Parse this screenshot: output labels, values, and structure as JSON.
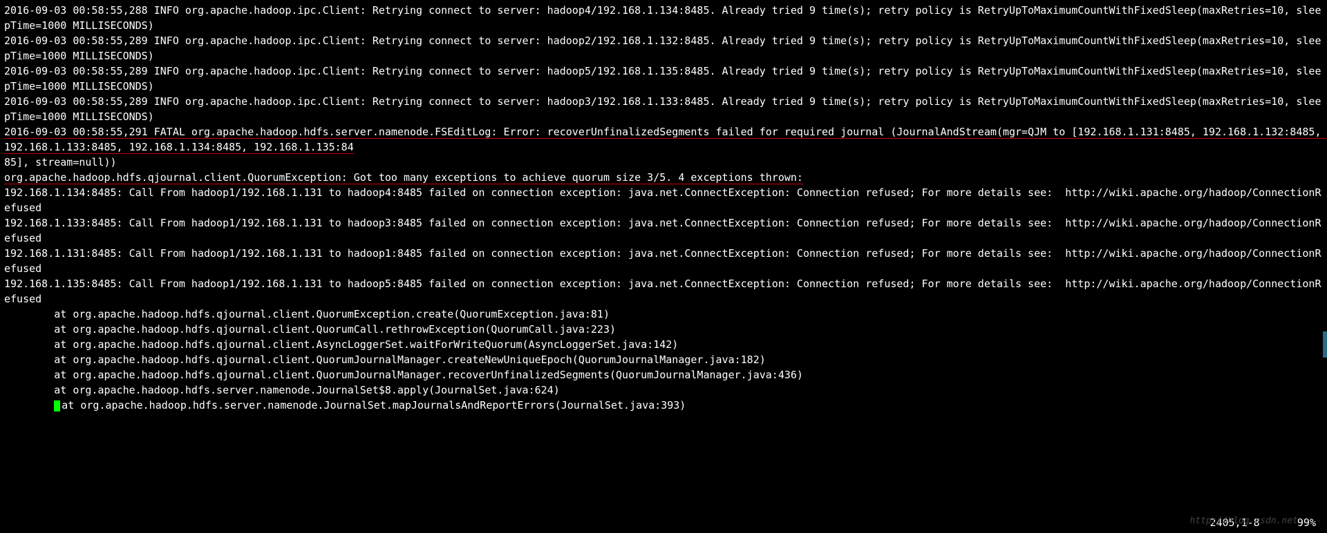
{
  "log": {
    "info1_a": "2016-09-03 00:58:55,288 INFO org.apache.hadoop.ipc.Client: Retrying connect to server: hadoop4/192.168.1.134:8485. Already tried 9 time(s); retry policy is RetryUpToMaximumCountWithFixedSleep(maxRetries=10, sleepTime=1000 MILLISECONDS)",
    "info2_a": "2016-09-03 00:58:55,289 INFO org.apache.hadoop.ipc.Client: Retrying connect to server: hadoop2/192.168.1.132:8485. Already tried 9 time(s); retry policy is RetryUpToMaximumCountWithFixedSleep(maxRetries=10, sleepTime=1000 MILLISECONDS)",
    "info3_a": "2016-09-03 00:58:55,289 INFO org.apache.hadoop.ipc.Client: Retrying connect to server: hadoop5/192.168.1.135:8485. Already tried 9 time(s); retry policy is RetryUpToMaximumCountWithFixedSleep(maxRetries=10, sleepTime=1000 MILLISECONDS)",
    "info4_a": "2016-09-03 00:58:55,289 INFO org.apache.hadoop.ipc.Client: Retrying connect to server: hadoop3/192.168.1.133:8485. Already tried 9 time(s); retry policy is RetryUpToMaximumCountWithFixedSleep(maxRetries=10, sleepTime=1000 MILLISECONDS)",
    "fatal_a": "2016-09-03 00:58:55,291 FATAL org.apache.hadoop.hdfs.server.namenode.FSEditLog: Error: recoverUnfinalizedSegments failed for required journal (JournalAndStream(mgr=QJM to [192.168.1.131:8485, 192.168.1.132:8485, 192.168.1.133:8485, 192.168.1.134:8485, 192.168.1.135:84",
    "fatal_b": "85], stream=null))",
    "quorum": "org.apache.hadoop.hdfs.qjournal.client.QuorumException: Got too many exceptions to achieve quorum size 3/5. 4 exceptions thrown:",
    "ex1": "192.168.1.134:8485: Call From hadoop1/192.168.1.131 to hadoop4:8485 failed on connection exception: java.net.ConnectException: Connection refused; For more details see:  http://wiki.apache.org/hadoop/ConnectionRefused",
    "ex2": "192.168.1.133:8485: Call From hadoop1/192.168.1.131 to hadoop3:8485 failed on connection exception: java.net.ConnectException: Connection refused; For more details see:  http://wiki.apache.org/hadoop/ConnectionRefused",
    "ex3": "192.168.1.131:8485: Call From hadoop1/192.168.1.131 to hadoop1:8485 failed on connection exception: java.net.ConnectException: Connection refused; For more details see:  http://wiki.apache.org/hadoop/ConnectionRefused",
    "ex4": "192.168.1.135:8485: Call From hadoop1/192.168.1.131 to hadoop5:8485 failed on connection exception: java.net.ConnectException: Connection refused; For more details see:  http://wiki.apache.org/hadoop/ConnectionRefused",
    "st1": "        at org.apache.hadoop.hdfs.qjournal.client.QuorumException.create(QuorumException.java:81)",
    "st2": "        at org.apache.hadoop.hdfs.qjournal.client.QuorumCall.rethrowException(QuorumCall.java:223)",
    "st3": "        at org.apache.hadoop.hdfs.qjournal.client.AsyncLoggerSet.waitForWriteQuorum(AsyncLoggerSet.java:142)",
    "st4": "        at org.apache.hadoop.hdfs.qjournal.client.QuorumJournalManager.createNewUniqueEpoch(QuorumJournalManager.java:182)",
    "st5": "        at org.apache.hadoop.hdfs.qjournal.client.QuorumJournalManager.recoverUnfinalizedSegments(QuorumJournalManager.java:436)",
    "st6": "        at org.apache.hadoop.hdfs.server.namenode.JournalSet$8.apply(JournalSet.java:624)",
    "st7_pad": "        ",
    "st7": "at org.apache.hadoop.hdfs.server.namenode.JournalSet.mapJournalsAndReportErrors(JournalSet.java:393)"
  },
  "status": {
    "position": "2405,1-8",
    "percent": "99%"
  },
  "watermark": "http://blog.csdn.net"
}
